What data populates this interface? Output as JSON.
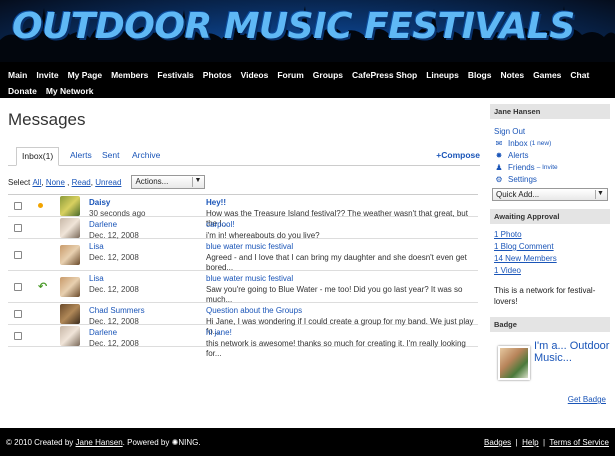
{
  "site": {
    "title": "OUTDOOR MUSIC FESTIVALS"
  },
  "nav": {
    "row1": [
      "Main",
      "Invite",
      "My Page",
      "Members",
      "Festivals",
      "Photos",
      "Videos",
      "Forum",
      "Groups",
      "CafePress Shop",
      "Lineups",
      "Blogs",
      "Notes",
      "Games",
      "Chat"
    ],
    "row2": [
      "Donate",
      "My Network"
    ]
  },
  "main": {
    "title": "Messages",
    "tabs": [
      "Inbox(1)",
      "Alerts",
      "Sent",
      "Archive"
    ],
    "compose": "Compose",
    "select": {
      "label": "Select",
      "all": "All",
      "none": "None",
      "read": "Read",
      "unread": "Unread"
    },
    "actions": "Actions...",
    "messages": [
      {
        "sender": "Daisy",
        "date": "30 seconds ago",
        "subject": "Hey!!",
        "snippet": "How was the Treasure Island festival?? The weather wasn't that great, but the I...",
        "unread": true,
        "replied": false
      },
      {
        "sender": "Darlene",
        "date": "Dec. 12, 2008",
        "subject": "carpool!",
        "snippet": "i'm in! whereabouts do you live?",
        "unread": false,
        "replied": false
      },
      {
        "sender": "Lisa",
        "date": "Dec. 12, 2008",
        "subject": "blue water music festival",
        "snippet": "Agreed - and I love that I can bring my daughter and she doesn't even get bored...",
        "unread": false,
        "replied": false
      },
      {
        "sender": "Lisa",
        "date": "Dec. 12, 2008",
        "subject": "blue water music festival",
        "snippet": "Saw you're going to Blue Water - me too! Did you go last year? It was so much...",
        "unread": false,
        "replied": true
      },
      {
        "sender": "Chad Summers",
        "date": "Dec. 12, 2008",
        "subject": "Question about the Groups",
        "snippet": "Hi Jane, I was wondering if I could create a group for my band. We just play fo...",
        "unread": false,
        "replied": false
      },
      {
        "sender": "Darlene",
        "date": "Dec. 12, 2008",
        "subject": "hi jane!",
        "snippet": "this network is awesome! thanks so much for creating it. I'm really looking for...",
        "unread": false,
        "replied": false
      }
    ]
  },
  "sidebar": {
    "user": "Jane Hansen",
    "sign_out": "Sign Out",
    "inbox": "Inbox",
    "inbox_new": "(1 new)",
    "alerts": "Alerts",
    "friends": "Friends",
    "invite": "– Invite",
    "settings": "Settings",
    "quick_add": "Quick Add...",
    "approval_title": "Awaiting Approval",
    "approval": [
      "1 Photo",
      "1 Blog Comment",
      "14 New Members",
      "1 Video"
    ],
    "network_text": "This is a network for festival-lovers!",
    "badge_title": "Badge",
    "badge_text": "I'm a... Outdoor Music...",
    "get_badge": "Get Badge"
  },
  "footer": {
    "copyright": "© 2010  Created by",
    "creator": "Jane Hansen",
    "powered": ".   Powered by",
    "ning": "NING.",
    "links": [
      "Badges",
      "Help",
      "Terms of Service"
    ]
  },
  "colors": {
    "link": "#1a55b8",
    "nav_bg": "#000000",
    "title_blue": "#5fb8f5"
  }
}
